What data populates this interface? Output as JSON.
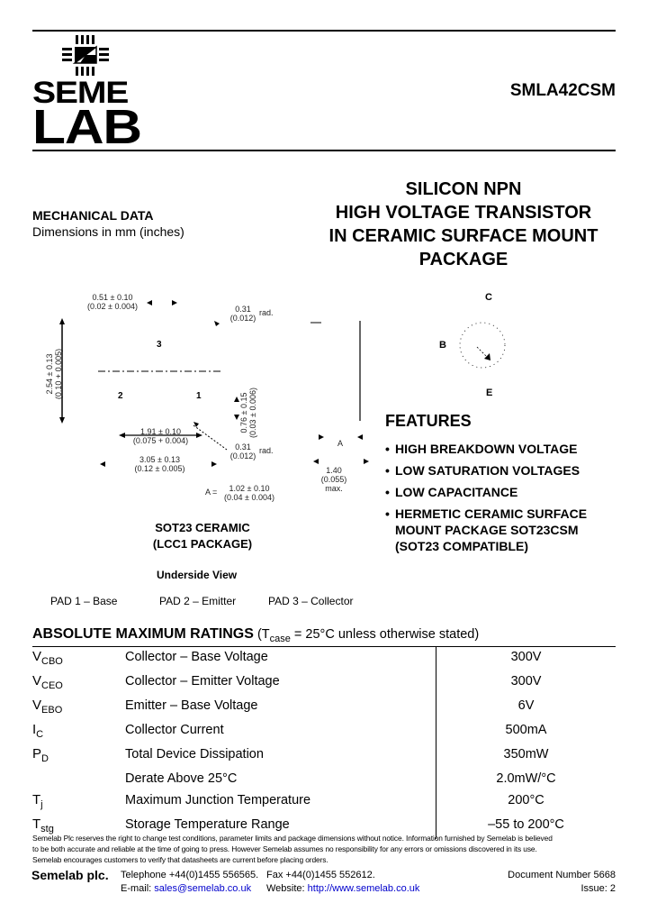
{
  "header": {
    "logo": {
      "line1": "SEME",
      "line2": "LAB"
    },
    "part_number": "SMLA42CSM"
  },
  "title": {
    "lines": [
      "SILICON NPN",
      "HIGH VOLTAGE TRANSISTOR",
      "IN CERAMIC SURFACE MOUNT",
      "PACKAGE"
    ]
  },
  "mechanical": {
    "heading": "MECHANICAL DATA",
    "subheading": "Dimensions in mm (inches)",
    "dims": {
      "pad_width": [
        "0.51 ± 0.10",
        "(0.02 ± 0.004)"
      ],
      "corner_rad_top": [
        "0.31",
        "(0.012)",
        "rad."
      ],
      "height": [
        "2.54 ± 0.13",
        "(0.10 + 0.005)"
      ],
      "pad_height": [
        "0.76 ± 0.15",
        "(0.03 ± 0.006)"
      ],
      "pad_pitch": [
        "1.91 ± 0.10",
        "(0.075 + 0.004)"
      ],
      "corner_rad_bottom": [
        "0.31",
        "(0.012)",
        "rad."
      ],
      "width": [
        "3.05 ± 0.13",
        "(0.12 ± 0.005)"
      ],
      "a_label": "A",
      "side_height": [
        "1.40",
        "(0.055)",
        "max."
      ],
      "a_value": [
        "A =",
        "1.02 ± 0.10",
        "(0.04 ± 0.004)"
      ]
    },
    "pad_labels": [
      "1",
      "2",
      "3"
    ],
    "package_name": [
      "SOT23 CERAMIC",
      "(LCC1 PACKAGE)"
    ],
    "view_label": "Underside View",
    "pads": [
      "PAD 1 – Base",
      "PAD 2 – Emitter",
      "PAD 3 – Collector"
    ]
  },
  "symbol": {
    "collector": "C",
    "base": "B",
    "emitter": "E"
  },
  "features": {
    "heading": "FEATURES",
    "items": [
      "HIGH BREAKDOWN VOLTAGE",
      "LOW SATURATION VOLTAGES",
      "LOW CAPACITANCE",
      "HERMETIC CERAMIC SURFACE MOUNT PACKAGE SOT23CSM (SOT23 COMPATIBLE)"
    ]
  },
  "ratings": {
    "heading": "ABSOLUTE MAXIMUM RATINGS",
    "condition_prefix": "(T",
    "condition_sub": "case",
    "condition_suffix": " = 25°C unless otherwise stated)",
    "rows": [
      {
        "sym": "V",
        "sub": "CBO",
        "desc": "Collector – Base Voltage",
        "value": "300V"
      },
      {
        "sym": "V",
        "sub": "CEO",
        "desc": "Collector – Emitter Voltage",
        "value": "300V"
      },
      {
        "sym": "V",
        "sub": "EBO",
        "desc": "Emitter – Base Voltage",
        "value": "6V"
      },
      {
        "sym": "I",
        "sub": "C",
        "desc": "Collector Current",
        "value": "500mA"
      },
      {
        "sym": "P",
        "sub": "D",
        "desc": "Total Device Dissipation",
        "value": "350mW"
      },
      {
        "sym": "",
        "sub": "",
        "desc": "Derate Above 25°C",
        "value": "2.0mW/°C"
      },
      {
        "sym": "T",
        "sub": "j",
        "desc": "Maximum Junction Temperature",
        "value": "200°C"
      },
      {
        "sym": "T",
        "sub": "stg",
        "desc": "Storage Temperature Range",
        "value": "–55 to 200°C"
      }
    ]
  },
  "footer": {
    "disclaimer": [
      "Semelab Plc reserves the right to change test conditions, parameter limits and package dimensions without notice. Information furnished by Semelab is believed",
      "to be both accurate and reliable at the time of going to press. However Semelab assumes no responsibility for any errors or omissions discovered in its use.",
      "Semelab encourages customers to verify that datasheets are current before placing orders."
    ],
    "company": "Semelab plc.",
    "telephone": "Telephone +44(0)1455 556565.",
    "fax": "Fax +44(0)1455 552612.",
    "email_label": "E-mail:",
    "email": "sales@semelab.co.uk",
    "website_label": "Website:",
    "website": "http://www.semelab.co.uk",
    "doc_number": "Document Number 5668",
    "issue": "Issue: 2"
  }
}
